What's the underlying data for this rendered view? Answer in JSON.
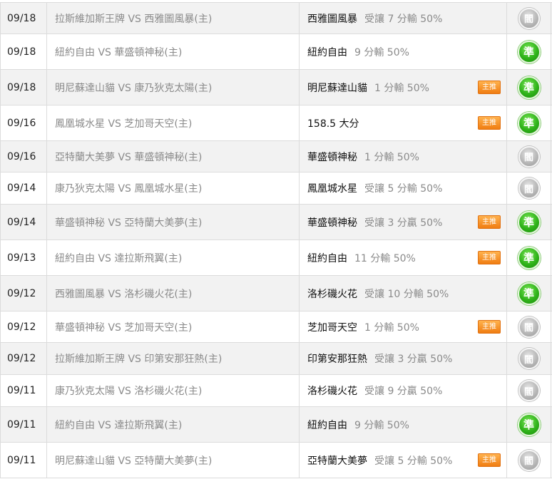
{
  "colors": {
    "win": "#2fb31a",
    "lose": "#b4b4b4",
    "badge": "#f07d12"
  },
  "rows": [
    {
      "date": "09/18",
      "match": "拉斯維加斯王牌 VS 西雅圖風暴(主)",
      "pick_team": "西雅圖風暴",
      "pick_line": "受讓 7 分輸 50%",
      "badge": "",
      "result": "閻",
      "status": "lose"
    },
    {
      "date": "09/18",
      "match": "紐約自由 VS 華盛頓神秘(主)",
      "pick_team": "紐約自由",
      "pick_line": "9 分輸 50%",
      "badge": "",
      "result": "準",
      "status": "win"
    },
    {
      "date": "09/18",
      "match": "明尼蘇達山貓 VS 康乃狄克太陽(主)",
      "pick_team": "明尼蘇達山貓",
      "pick_line": "1 分輸 50%",
      "badge": "主推",
      "result": "準",
      "status": "win"
    },
    {
      "date": "09/16",
      "match": "鳳凰城水星 VS 芝加哥天空(主)",
      "pick_team": "158.5 大分",
      "pick_line": "",
      "badge": "主推",
      "result": "準",
      "status": "win"
    },
    {
      "date": "09/16",
      "match": "亞特蘭大美夢 VS 華盛頓神秘(主)",
      "pick_team": "華盛頓神秘",
      "pick_line": "1 分輸 50%",
      "badge": "",
      "result": "閻",
      "status": "lose"
    },
    {
      "date": "09/14",
      "match": "康乃狄克太陽 VS 鳳凰城水星(主)",
      "pick_team": "鳳凰城水星",
      "pick_line": "受讓 5 分輸 50%",
      "badge": "",
      "result": "閻",
      "status": "lose"
    },
    {
      "date": "09/14",
      "match": "華盛頓神秘 VS 亞特蘭大美夢(主)",
      "pick_team": "華盛頓神秘",
      "pick_line": "受讓 3 分贏 50%",
      "badge": "主推",
      "result": "準",
      "status": "win"
    },
    {
      "date": "09/13",
      "match": "紐約自由 VS 達拉斯飛翼(主)",
      "pick_team": "紐約自由",
      "pick_line": "11 分輸 50%",
      "badge": "主推",
      "result": "準",
      "status": "win"
    },
    {
      "date": "09/12",
      "match": "西雅圖風暴 VS 洛杉磯火花(主)",
      "pick_team": "洛杉磯火花",
      "pick_line": "受讓 10 分輸 50%",
      "badge": "",
      "result": "準",
      "status": "win"
    },
    {
      "date": "09/12",
      "match": "華盛頓神秘 VS 芝加哥天空(主)",
      "pick_team": "芝加哥天空",
      "pick_line": "1 分輸 50%",
      "badge": "主推",
      "result": "閻",
      "status": "lose"
    },
    {
      "date": "09/12",
      "match": "拉斯維加斯王牌 VS 印第安那狂熱(主)",
      "pick_team": "印第安那狂熱",
      "pick_line": "受讓 3 分贏 50%",
      "badge": "",
      "result": "閻",
      "status": "lose"
    },
    {
      "date": "09/11",
      "match": "康乃狄克太陽 VS 洛杉磯火花(主)",
      "pick_team": "洛杉磯火花",
      "pick_line": "受讓 9 分贏 50%",
      "badge": "",
      "result": "閻",
      "status": "lose"
    },
    {
      "date": "09/11",
      "match": "紐約自由 VS 達拉斯飛翼(主)",
      "pick_team": "紐約自由",
      "pick_line": "9 分輸 50%",
      "badge": "",
      "result": "準",
      "status": "win"
    },
    {
      "date": "09/11",
      "match": "明尼蘇達山貓 VS 亞特蘭大美夢(主)",
      "pick_team": "亞特蘭大美夢",
      "pick_line": "受讓 5 分輸 50%",
      "badge": "主推",
      "result": "閻",
      "status": "lose"
    }
  ]
}
